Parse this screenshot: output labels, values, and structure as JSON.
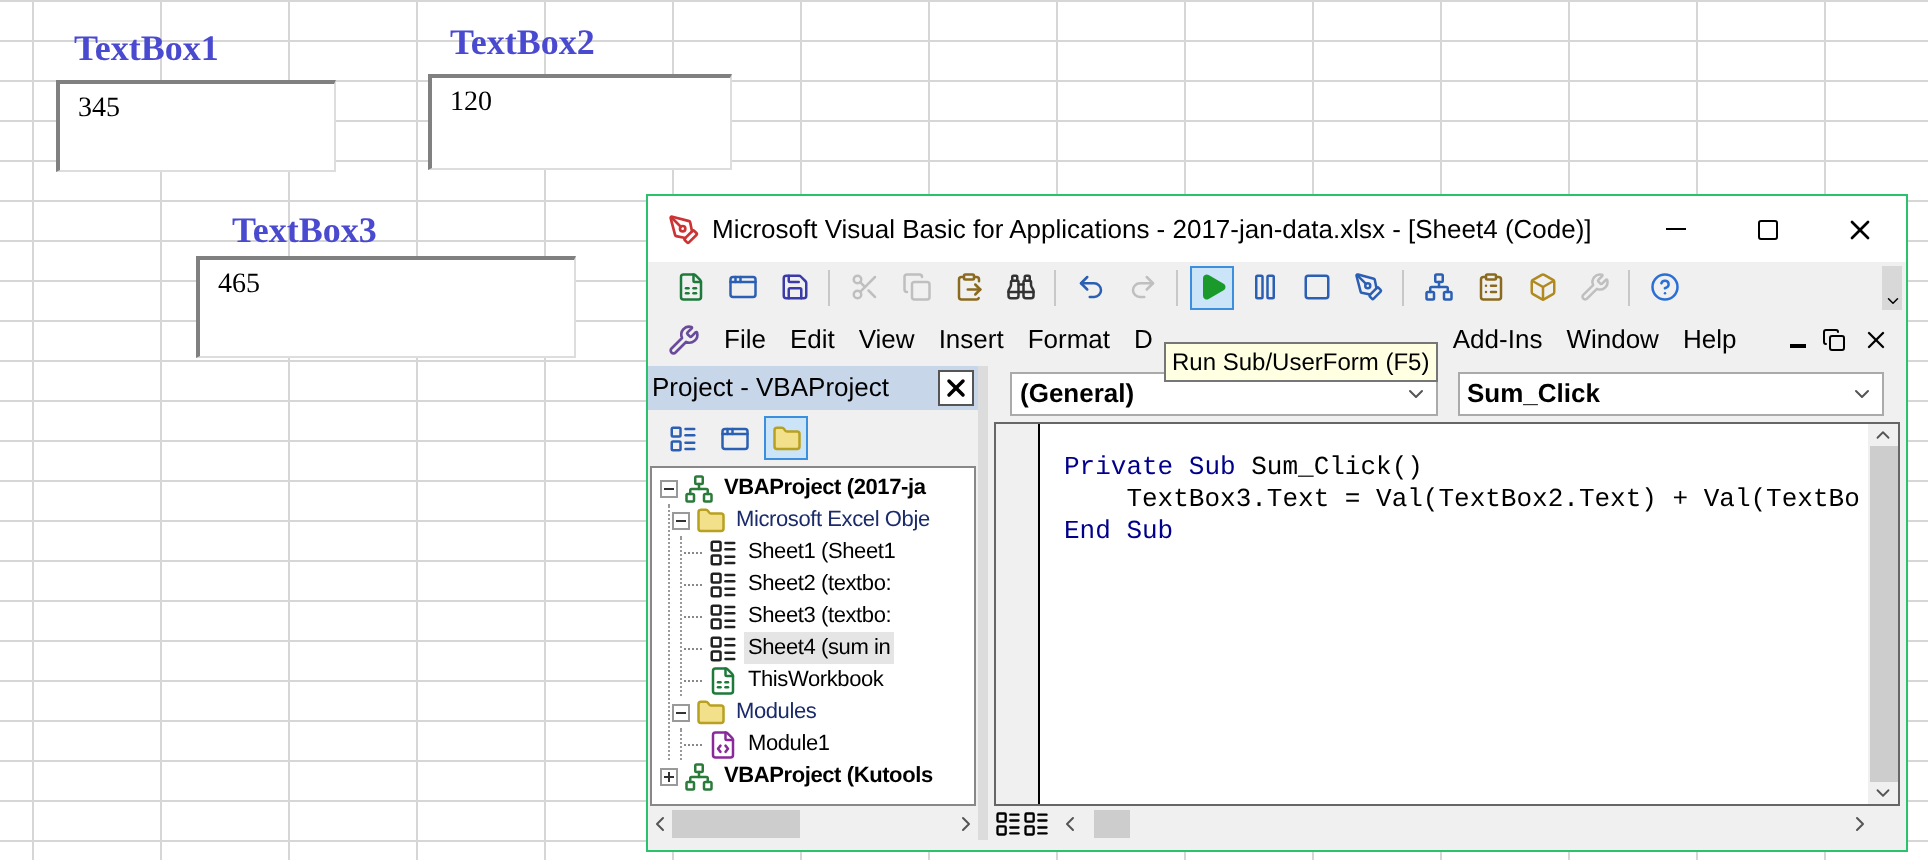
{
  "sheet": {
    "textboxes": [
      {
        "label": "TextBox1",
        "value": "345"
      },
      {
        "label": "TextBox2",
        "value": "120"
      },
      {
        "label": "TextBox3",
        "value": "465"
      }
    ]
  },
  "window": {
    "title": "Microsoft Visual Basic for Applications - 2017-jan-data.xlsx - [Sheet4 (Code)]"
  },
  "toolbar": [
    {
      "kind": "excel",
      "disabled": false,
      "pressed": false
    },
    {
      "kind": "userform",
      "disabled": false,
      "pressed": false
    },
    {
      "kind": "save",
      "disabled": false,
      "pressed": false
    },
    {
      "kind": "sep"
    },
    {
      "kind": "cut",
      "disabled": true,
      "pressed": false
    },
    {
      "kind": "copy",
      "disabled": true,
      "pressed": false
    },
    {
      "kind": "paste",
      "disabled": false,
      "pressed": false
    },
    {
      "kind": "find",
      "disabled": false,
      "pressed": false
    },
    {
      "kind": "sep"
    },
    {
      "kind": "undo",
      "disabled": false,
      "pressed": false
    },
    {
      "kind": "redo",
      "disabled": true,
      "pressed": false
    },
    {
      "kind": "sep"
    },
    {
      "kind": "run",
      "disabled": false,
      "pressed": true
    },
    {
      "kind": "pause",
      "disabled": false,
      "pressed": false
    },
    {
      "kind": "stop",
      "disabled": false,
      "pressed": false
    },
    {
      "kind": "design",
      "disabled": false,
      "pressed": false
    },
    {
      "kind": "sep"
    },
    {
      "kind": "explorer",
      "disabled": false,
      "pressed": false
    },
    {
      "kind": "properties",
      "disabled": false,
      "pressed": false
    },
    {
      "kind": "browser",
      "disabled": false,
      "pressed": false
    },
    {
      "kind": "toolbox",
      "disabled": true,
      "pressed": false
    },
    {
      "kind": "sep"
    },
    {
      "kind": "help",
      "disabled": false,
      "pressed": false
    }
  ],
  "menu": [
    {
      "label": "File",
      "kind": "item"
    },
    {
      "label": "Edit",
      "kind": "item"
    },
    {
      "label": "View",
      "kind": "item"
    },
    {
      "label": "Insert",
      "kind": "item"
    },
    {
      "label": "Format",
      "kind": "item"
    },
    {
      "label": "D",
      "kind": "item"
    },
    {
      "kind": "gap"
    },
    {
      "label": "Add-Ins",
      "kind": "item"
    },
    {
      "label": "Window",
      "kind": "item"
    },
    {
      "label": "Help",
      "kind": "item"
    }
  ],
  "tooltip": "Run Sub/UserForm (F5)",
  "project_pane": {
    "title": "Project - VBAProject",
    "tools": [
      {
        "kind": "code",
        "pressed": false
      },
      {
        "kind": "object",
        "pressed": false
      },
      {
        "kind": "folders",
        "pressed": true
      }
    ],
    "tree": [
      {
        "label": "VBAProject (2017-ja",
        "kind": "project",
        "expanded": true,
        "selected": false,
        "children": [
          {
            "label": "Microsoft Excel Obje",
            "kind": "folder",
            "expanded": true,
            "selected": false,
            "children": [
              {
                "label": "Sheet1 (Sheet1",
                "kind": "sheet",
                "selected": false
              },
              {
                "label": "Sheet2 (textbo:",
                "kind": "sheet",
                "selected": false
              },
              {
                "label": "Sheet3 (textbo:",
                "kind": "sheet",
                "selected": false
              },
              {
                "label": "Sheet4 (sum in",
                "kind": "sheet",
                "selected": true
              },
              {
                "label": "ThisWorkbook",
                "kind": "workbook",
                "selected": false
              }
            ]
          },
          {
            "label": "Modules",
            "kind": "folder",
            "expanded": true,
            "selected": false,
            "children": [
              {
                "label": "Module1",
                "kind": "module",
                "selected": false
              }
            ]
          }
        ]
      },
      {
        "label": "VBAProject (Kutools",
        "kind": "project",
        "expanded": false,
        "selected": false
      }
    ]
  },
  "code": {
    "object": "(General)",
    "procedure": "Sum_Click",
    "lines": [
      [
        {
          "text": "Private Sub",
          "kind": "keyword"
        },
        {
          "text": " Sum_Click()",
          "kind": "plain"
        }
      ],
      [
        {
          "text": "    TextBox3.Text = Val(TextBox2.Text) + Val(TextBo",
          "kind": "plain"
        }
      ],
      [
        {
          "text": "End Sub",
          "kind": "keyword"
        }
      ]
    ]
  }
}
